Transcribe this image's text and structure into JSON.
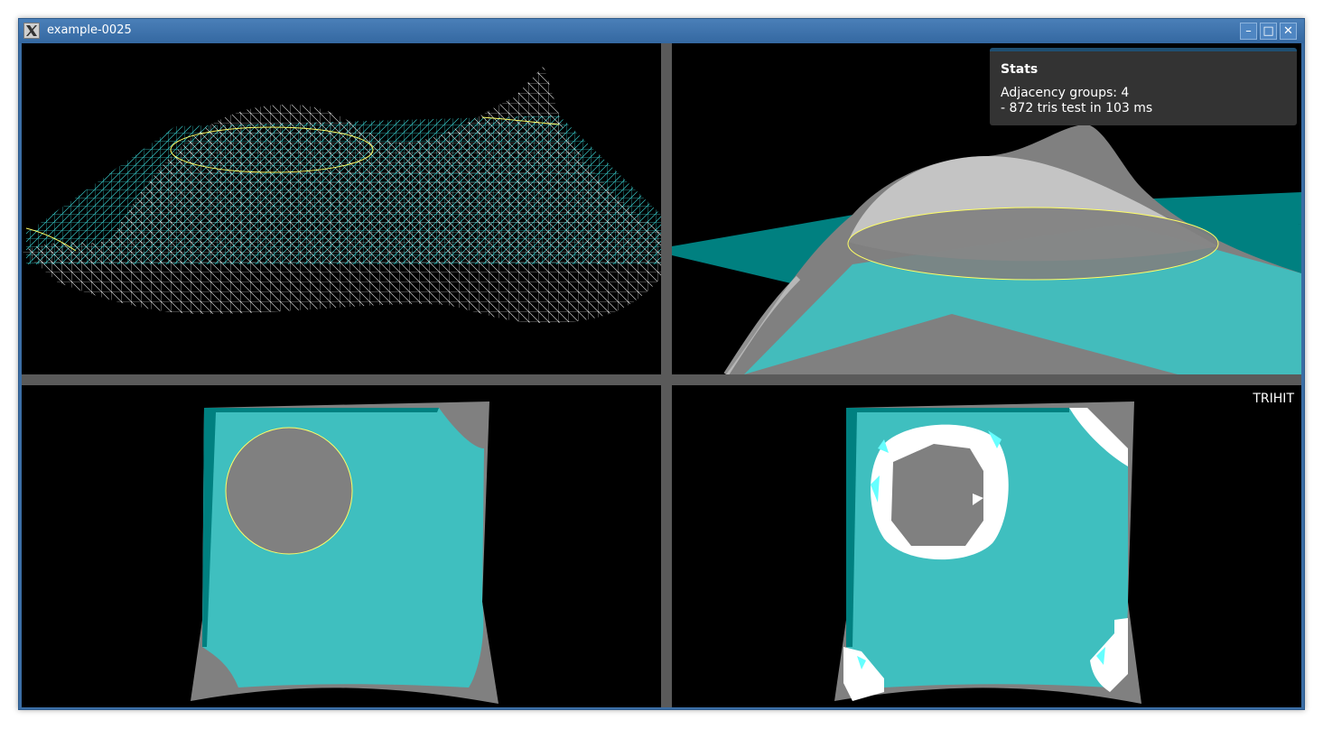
{
  "window": {
    "title": "example-0025",
    "icon": "x11-logo-icon",
    "buttons": {
      "minimize": "–",
      "maximize": "□",
      "close": "✕"
    }
  },
  "stats": {
    "title": "Stats",
    "adjacency": "Adjacency groups: 4",
    "tris_test": "- 872 tris test in 103 ms"
  },
  "viewports": {
    "bottom_right_label": "TRIHIT"
  },
  "colors": {
    "plane": "#3fbfbf",
    "plane_dark": "#008080",
    "mesh": "#808080",
    "wire_white": "#ffffff",
    "wire_cyan": "#38d0d0",
    "intersection": "#ffff66",
    "hit": "#ffffff",
    "hit_edge": "#66ffff",
    "titlebar": "#3b6ea5"
  }
}
